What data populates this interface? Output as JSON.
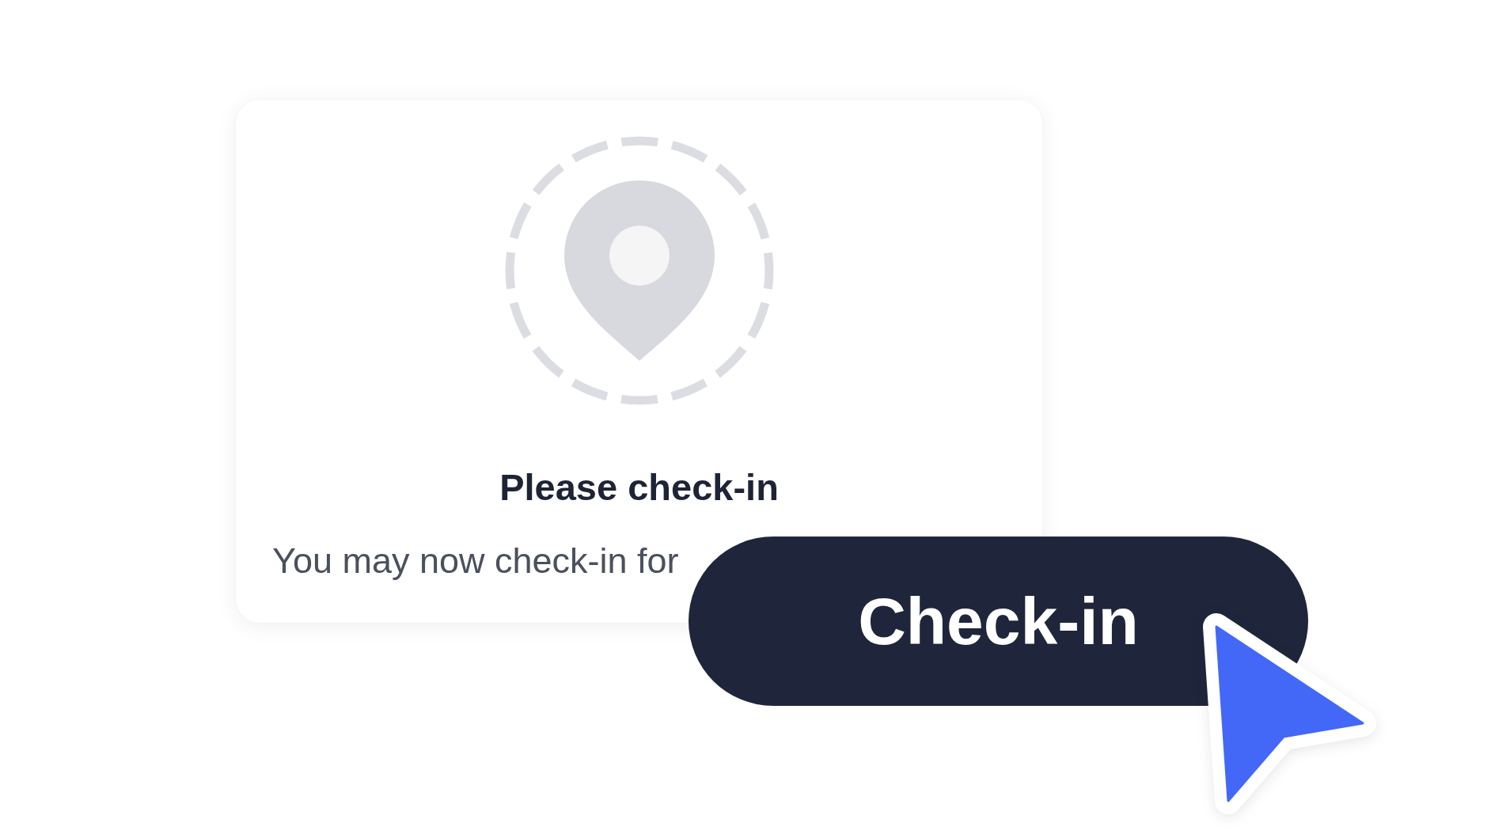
{
  "card": {
    "title": "Please check-in",
    "message": "You may now check-in for"
  },
  "button": {
    "label": "Check-in"
  }
}
